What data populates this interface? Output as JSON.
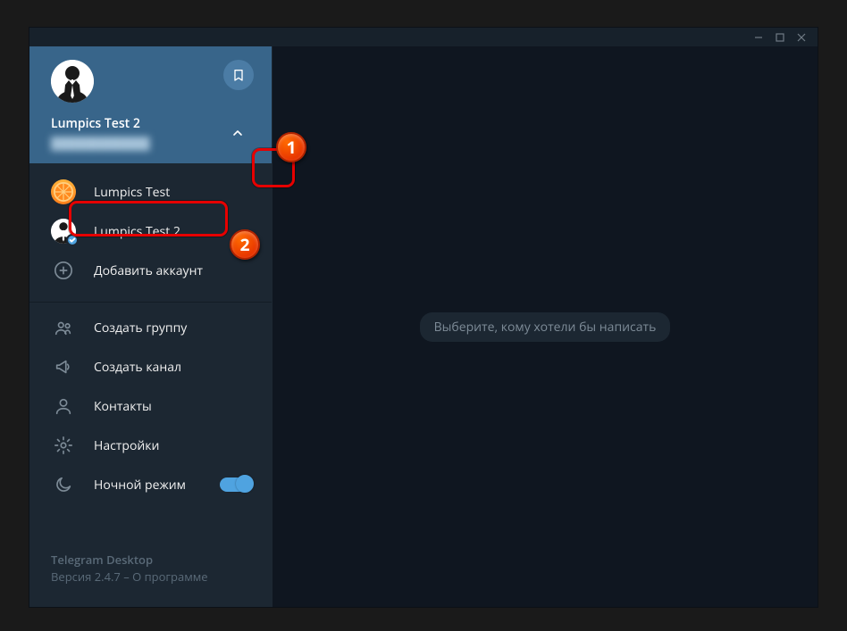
{
  "profile": {
    "name": "Lumpics Test 2"
  },
  "accounts": [
    {
      "label": "Lumpics Test",
      "active": false
    },
    {
      "label": "Lumpics Test 2",
      "active": true
    }
  ],
  "addAccount": "Добавить аккаунт",
  "menu": {
    "newGroup": "Создать группу",
    "newChannel": "Создать канал",
    "contacts": "Контакты",
    "settings": "Настройки",
    "nightMode": "Ночной режим"
  },
  "footer": {
    "appName": "Telegram Desktop",
    "version": "Версия 2.4.7 – О программе"
  },
  "main": {
    "placeholder": "Выберите, кому хотели бы написать"
  }
}
